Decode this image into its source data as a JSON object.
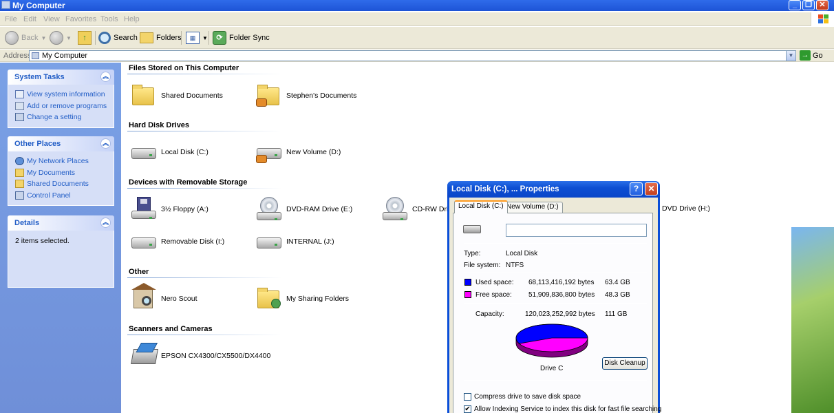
{
  "window": {
    "title": "My Computer"
  },
  "menu": [
    "File",
    "Edit",
    "View",
    "Favorites",
    "Tools",
    "Help"
  ],
  "toolbar": {
    "back_label": "Back",
    "search_label": "Search",
    "folders_label": "Folders",
    "folder_sync_label": "Folder Sync"
  },
  "address": {
    "label": "Address",
    "value": "My Computer",
    "go_label": "Go"
  },
  "left": {
    "system_tasks": {
      "title": "System Tasks",
      "items": [
        "View system information",
        "Add or remove programs",
        "Change a setting"
      ]
    },
    "other_places": {
      "title": "Other Places",
      "items": [
        "My Network Places",
        "My Documents",
        "Shared Documents",
        "Control Panel"
      ]
    },
    "details": {
      "title": "Details",
      "text": "2 items selected."
    }
  },
  "groups": {
    "files": {
      "title": "Files Stored on This Computer",
      "items": [
        "Shared Documents",
        "Stephen's Documents"
      ]
    },
    "hdd": {
      "title": "Hard Disk Drives",
      "items": [
        "Local Disk (C:)",
        "New Volume (D:)"
      ]
    },
    "removable": {
      "title": "Devices with Removable Storage",
      "items": [
        "3½ Floppy (A:)",
        "DVD-RAM Drive (E:)",
        "CD-RW Drive",
        "DVD Drive (H:)",
        "Removable Disk (I:)",
        "INTERNAL (J:)"
      ]
    },
    "other": {
      "title": "Other",
      "items": [
        "Nero Scout",
        "My Sharing Folders"
      ]
    },
    "scanners": {
      "title": "Scanners and Cameras",
      "items": [
        "EPSON CX4300/CX5500/DX4400"
      ]
    }
  },
  "dialog": {
    "title": "Local Disk (C:), ... Properties",
    "tabs": [
      "Local Disk (C:)",
      "New Volume (D:)"
    ],
    "volume_label": "",
    "type_label": "Type:",
    "type_value": "Local Disk",
    "fs_label": "File system:",
    "fs_value": "NTFS",
    "used_label": "Used space:",
    "used_bytes": "68,113,416,192 bytes",
    "used_gb": "63.4 GB",
    "free_label": "Free space:",
    "free_bytes": "51,909,836,800 bytes",
    "free_gb": "48.3 GB",
    "capacity_label": "Capacity:",
    "capacity_bytes": "120,023,252,992 bytes",
    "capacity_gb": "111 GB",
    "drive_label": "Drive C",
    "cleanup_label": "Disk Cleanup",
    "compress_label": "Compress drive to save disk space",
    "index_label": "Allow Indexing Service to index this disk for fast file searching",
    "used_color": "#0000ff",
    "free_color": "#ff00ff",
    "used_fraction": 0.567
  }
}
